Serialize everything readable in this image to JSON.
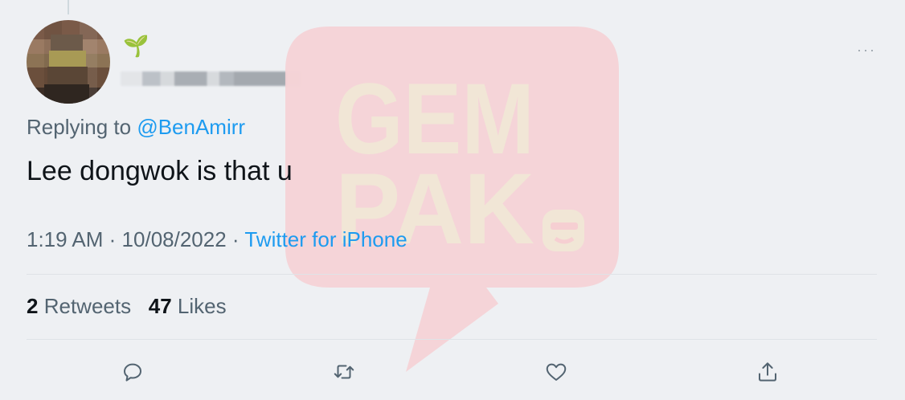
{
  "tweet": {
    "replying_prefix": "Replying to",
    "replying_handle": "@BenAmirr",
    "text": "Lee dongwok is that u",
    "time": "1:19 AM",
    "date": "10/08/2022",
    "source": "Twitter for iPhone",
    "retweets_count": "2",
    "retweets_label": "Retweets",
    "likes_count": "47",
    "likes_label": "Likes",
    "more_glyph": "···",
    "name_emoji": "🌱"
  },
  "watermark": {
    "line1": "GEM",
    "line2": "PAK",
    "bubble_color": "#f6cfd2",
    "text_color": "#f1e6d6"
  },
  "actions": [
    {
      "name": "reply",
      "icon": "reply-icon"
    },
    {
      "name": "retweet",
      "icon": "retweet-icon"
    },
    {
      "name": "like",
      "icon": "heart-icon"
    },
    {
      "name": "share",
      "icon": "share-icon"
    }
  ]
}
